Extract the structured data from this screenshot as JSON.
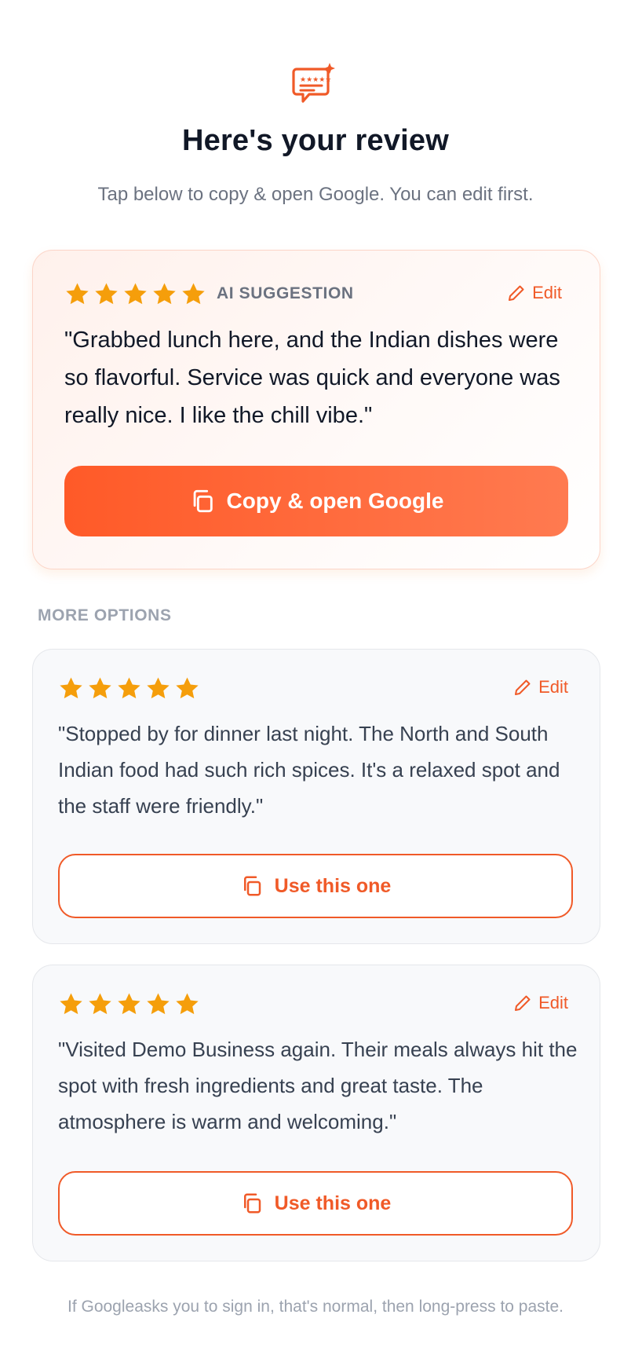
{
  "header": {
    "icon": "review-chat-icon",
    "title": "Here's your review",
    "subtitle": "Tap below to copy & open Google. You can edit first."
  },
  "primary_card": {
    "rating": 5,
    "label": "AI SUGGESTION",
    "edit_label": "Edit",
    "text": "\"Grabbed lunch here, and the Indian dishes were so flavorful. Service was quick and everyone was really nice. I like the chill vibe.\"",
    "button_label": "Copy & open Google"
  },
  "more_options": {
    "label": "MORE OPTIONS",
    "items": [
      {
        "rating": 5,
        "edit_label": "Edit",
        "text": "\"Stopped by for dinner last night. The North and South Indian food had such rich spices. It's a relaxed spot and the staff were friendly.\"",
        "button_label": "Use this one"
      },
      {
        "rating": 5,
        "edit_label": "Edit",
        "text": "\"Visited Demo Business again. Their meals always hit the spot with fresh ingredients and great taste. The atmosphere is warm and welcoming.\"",
        "button_label": "Use this one"
      }
    ]
  },
  "footer": {
    "note": "If Googleasks you to sign in, that's normal, then long-press to paste."
  },
  "colors": {
    "accent": "#f05a28",
    "star": "#f59e0b",
    "title": "#111827",
    "muted": "#6b7280"
  }
}
